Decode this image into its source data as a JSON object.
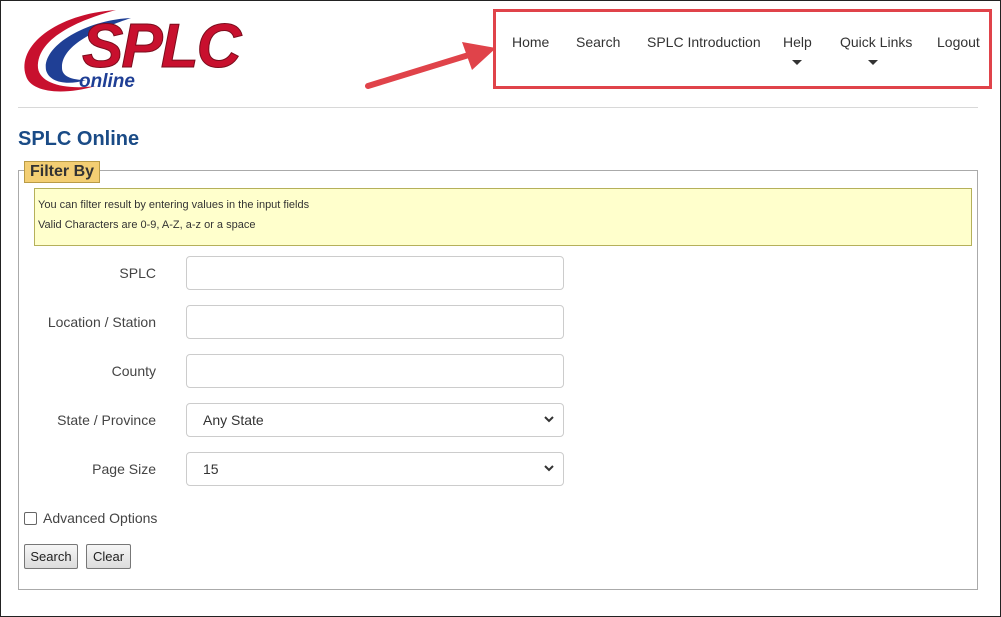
{
  "logo": {
    "main_text": "SPLC",
    "sub_text": "online"
  },
  "nav": {
    "items": [
      {
        "label": "Home",
        "has_dropdown": false
      },
      {
        "label": "Search",
        "has_dropdown": false
      },
      {
        "label": "SPLC Introduction",
        "has_dropdown": false
      },
      {
        "label": "Help",
        "has_dropdown": true
      },
      {
        "label": "Quick Links",
        "has_dropdown": true
      },
      {
        "label": "Logout",
        "has_dropdown": false
      }
    ]
  },
  "page": {
    "title": "SPLC Online"
  },
  "filter": {
    "legend": "Filter By",
    "info_line1": "You can filter result by entering values in the input fields",
    "info_line2": "Valid Characters are 0-9, A-Z, a-z or a space",
    "fields": {
      "splc": {
        "label": "SPLC",
        "value": ""
      },
      "location": {
        "label": "Location / Station",
        "value": ""
      },
      "county": {
        "label": "County",
        "value": ""
      },
      "state": {
        "label": "State / Province",
        "selected": "Any State"
      },
      "page_size": {
        "label": "Page Size",
        "selected": "15"
      }
    },
    "advanced_options_label": "Advanced Options",
    "search_button": "Search",
    "clear_button": "Clear"
  },
  "colors": {
    "title": "#1a4b86",
    "highlight_border": "#e0434a",
    "legend_bg": "#f3ce73",
    "info_bg": "#ffffcc",
    "logo_red": "#c8102e",
    "logo_blue": "#1f3f95"
  }
}
